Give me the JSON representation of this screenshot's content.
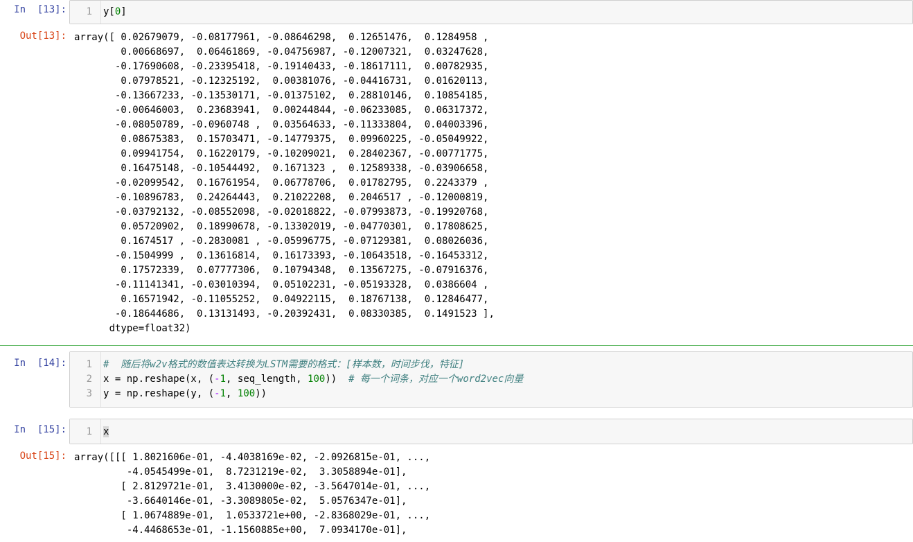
{
  "cells": [
    {
      "in_prompt": "In  [13]:",
      "line_numbers": [
        "1"
      ],
      "code": "y[0]",
      "out_prompt": "Out[13]:",
      "output": "array([ 0.02679079, -0.08177961, -0.08646298,  0.12651476,  0.1284958 ,\n        0.00668697,  0.06461869, -0.04756987, -0.12007321,  0.03247628,\n       -0.17690608, -0.23395418, -0.19140433, -0.18617111,  0.00782935,\n        0.07978521, -0.12325192,  0.00381076, -0.04416731,  0.01620113,\n       -0.13667233, -0.13530171, -0.01375102,  0.28810146,  0.10854185,\n       -0.00646003,  0.23683941,  0.00244844, -0.06233085,  0.06317372,\n       -0.08050789, -0.0960748 ,  0.03564633, -0.11333804,  0.04003396,\n        0.08675383,  0.15703471, -0.14779375,  0.09960225, -0.05049922,\n        0.09941754,  0.16220179, -0.10209021,  0.28402367, -0.00771775,\n        0.16475148, -0.10544492,  0.1671323 ,  0.12589338, -0.03906658,\n       -0.02099542,  0.16761954,  0.06778706,  0.01782795,  0.2243379 ,\n       -0.10896783,  0.24264443,  0.21022208,  0.2046517 , -0.12000819,\n       -0.03792132, -0.08552098, -0.02018822, -0.07993873, -0.19920768,\n        0.05720902,  0.18990678, -0.13302019, -0.04770301,  0.17808625,\n        0.1674517 , -0.2830081 , -0.05996775, -0.07129381,  0.08026036,\n       -0.1504999 ,  0.13616814,  0.16173393, -0.10643518, -0.16453312,\n        0.17572339,  0.07777306,  0.10794348,  0.13567275, -0.07916376,\n       -0.11141341, -0.03010394,  0.05102231, -0.05193328,  0.0386604 ,\n        0.16571942, -0.11055252,  0.04922115,  0.18767138,  0.12846477,\n       -0.18644686,  0.13131493, -0.20392431,  0.08330385,  0.1491523 ],\n      dtype=float32)"
    },
    {
      "in_prompt": "In  [14]:",
      "line_numbers": [
        "1",
        "2",
        "3"
      ],
      "code_lines": [
        "#  随后将w2v格式的数值表达转换为LSTM需要的格式：[样本数，时间步伐，特征]",
        "x = np.reshape(x, (-1, seq_length, 100))  # 每一个词条，对应一个word2vec向量",
        "y = np.reshape(y, (-1, 100))"
      ]
    },
    {
      "in_prompt": "In  [15]:",
      "line_numbers": [
        "1"
      ],
      "code": "x",
      "out_prompt": "Out[15]:",
      "output": "array([[[ 1.8021606e-01, -4.4038169e-02, -2.0926815e-01, ...,\n         -4.0545499e-01,  8.7231219e-02,  3.3058894e-01],\n        [ 2.8129721e-01,  3.4130000e-02, -3.5647014e-01, ...,\n         -3.6640146e-01, -3.3089805e-02,  5.0576347e-01],\n        [ 1.0674889e-01,  1.0533721e+00, -2.8368029e-01, ...,\n         -4.4468653e-01, -1.1560885e+00,  7.0934170e-01],"
    }
  ]
}
